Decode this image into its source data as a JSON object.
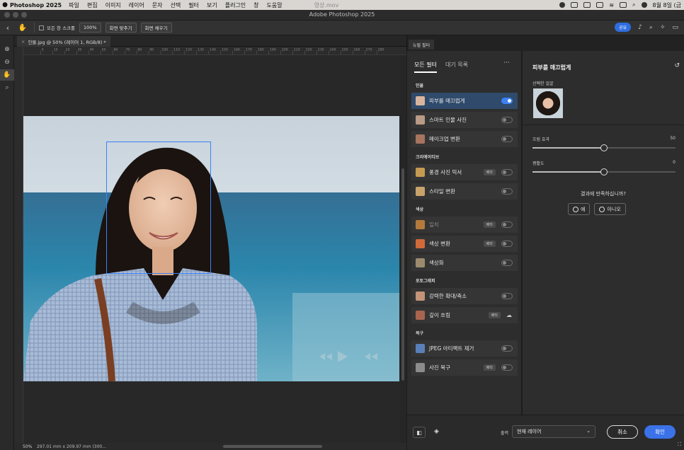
{
  "macmenu": {
    "app": "Photoshop 2025",
    "items": [
      "파일",
      "편집",
      "이미지",
      "레이어",
      "문자",
      "선택",
      "필터",
      "보기",
      "플러그인",
      "창",
      "도움말"
    ],
    "recording_title": "영상.mov",
    "clock": "8월 8일 (금"
  },
  "window": {
    "title": "Adobe Photoshop 2025"
  },
  "options_bar": {
    "scroll_all_label": "모든 창 스크롤",
    "zoom_100": "100%",
    "fit_screen": "화면 맞추기",
    "fill_screen": "화면 채우기",
    "share": "공유"
  },
  "document": {
    "tab_title": "인물.jpg @ 50% (레이어 1, RGB/8) *",
    "zoom": "50%",
    "dimensions": "297.01 mm x 209.97 mm (300..."
  },
  "ruler": {
    "top_ticks": [
      "0",
      "10",
      "20",
      "30",
      "40",
      "50",
      "60",
      "70",
      "80",
      "90",
      "100",
      "110",
      "120",
      "130",
      "140",
      "150",
      "160",
      "170",
      "180",
      "190",
      "200",
      "210",
      "220",
      "230",
      "240",
      "250",
      "260",
      "270",
      "280"
    ]
  },
  "panel": {
    "tab": "뉴럴 필터"
  },
  "neural_filters": {
    "tabs": [
      "모든 필터",
      "대기 목록"
    ],
    "groups": [
      {
        "name": "인물",
        "items": [
          {
            "label": "피부를 매끄럽게",
            "state": "on",
            "beta": false,
            "active": true,
            "dim": false,
            "thumb": "#d8b49c"
          },
          {
            "label": "스마트 인물 사진",
            "state": "off",
            "beta": false,
            "active": false,
            "dim": false,
            "thumb": "#b89a86"
          },
          {
            "label": "메이크업 변환",
            "state": "off",
            "beta": false,
            "active": false,
            "dim": false,
            "thumb": "#a7745f"
          }
        ]
      },
      {
        "name": "크리에이티브",
        "items": [
          {
            "label": "풍경 사진 믹서",
            "state": "off",
            "beta": true,
            "active": false,
            "dim": false,
            "thumb": "#c59a52"
          },
          {
            "label": "스타일 변환",
            "state": "off",
            "beta": false,
            "active": false,
            "dim": false,
            "thumb": "#c8a46a"
          }
        ]
      },
      {
        "name": "색상",
        "items": [
          {
            "label": "일치",
            "state": "off",
            "beta": true,
            "active": false,
            "dim": true,
            "thumb": "#b57a3b"
          },
          {
            "label": "색상 변환",
            "state": "off",
            "beta": true,
            "active": false,
            "dim": false,
            "thumb": "#d06a3a"
          },
          {
            "label": "색상화",
            "state": "off",
            "beta": false,
            "active": false,
            "dim": false,
            "thumb": "#9c8b6e"
          }
        ]
      },
      {
        "name": "포토그래피",
        "items": [
          {
            "label": "강력한 확대/축소",
            "state": "off",
            "beta": false,
            "active": false,
            "dim": false,
            "thumb": "#c39478"
          },
          {
            "label": "깊이 흐림",
            "state": "cloud",
            "beta": true,
            "active": false,
            "dim": false,
            "thumb": "#a9644f"
          }
        ]
      },
      {
        "name": "복구",
        "items": [
          {
            "label": "JPEG 아티팩트 제거",
            "state": "off",
            "beta": false,
            "active": false,
            "dim": false,
            "thumb": "#5a7fb8"
          },
          {
            "label": "사진 복구",
            "state": "off",
            "beta": true,
            "active": false,
            "dim": false,
            "thumb": "#8c8c8c"
          }
        ]
      }
    ],
    "beta_label": "베타"
  },
  "detail": {
    "title": "피부를 매끄럽게",
    "selected_face_label": "선택한 얼굴",
    "blur_label": "흐림 효과",
    "blur_value": 50,
    "smooth_label": "평활도",
    "smooth_value": 0,
    "satisfied_q": "결과에 만족하십니까?",
    "yes": "예",
    "no": "아니오"
  },
  "bottom": {
    "output_label": "출력",
    "output_value": "현재 레이어",
    "cancel": "취소",
    "ok": "확인"
  }
}
